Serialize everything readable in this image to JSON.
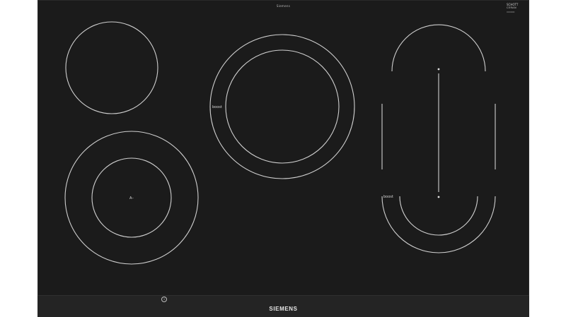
{
  "hob": {
    "top_label": "Siemens",
    "badge": {
      "line1": "SCHOTT",
      "line2": "CERAN",
      "line3": "000000"
    },
    "boost_label_center": "boost",
    "boost_label_right": "boost",
    "child_lock_label": "A–",
    "brand": "SIEMENS",
    "info_icon": "info-icon",
    "colors": {
      "glass": "#1b1b1b",
      "zone_line": "#cfcfcf",
      "control_bar": "#242424"
    }
  }
}
